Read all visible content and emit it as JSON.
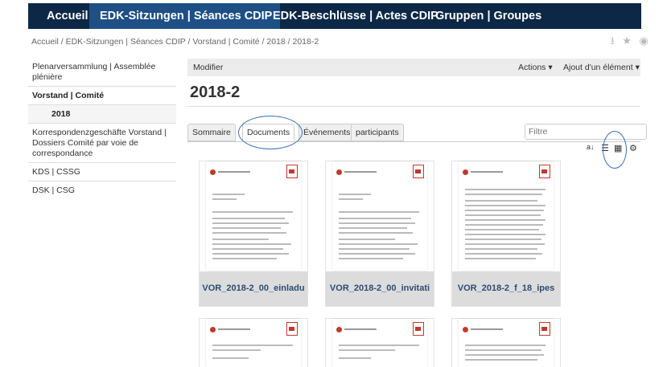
{
  "topnav": {
    "items": [
      "Accueil",
      "EDK-Sitzungen | Séances CDIP",
      "EDK-Beschlüsse | Actes CDIP",
      "Gruppen | Groupes"
    ]
  },
  "breadcrumb": "Accueil / EDK-Sitzungen | Séances CDIP / Vorstand | Comité / 2018 / 2018-2",
  "leftnav": {
    "items": [
      "Plenarversammlung | Assemblée plénière",
      "Vorstand | Comité",
      "2018",
      "Korrespondenzgeschäfte Vorstand | Dossiers Comité par voie de correspondance",
      "KDS | CSSG",
      "DSK | CSG"
    ]
  },
  "toolbar": {
    "modify": "Modifier",
    "actions": "Actions ▾",
    "add": "Ajout d'un élément ▾"
  },
  "page_title": "2018-2",
  "tabs": [
    "Sommaire",
    "Documents",
    "Événements",
    "participants"
  ],
  "active_tab": "Documents",
  "filter": {
    "placeholder": "Filtre"
  },
  "cards": [
    {
      "label": "VOR_2018-2_00_einladu"
    },
    {
      "label": "VOR_2018-2_00_invitati"
    },
    {
      "label": "VOR_2018-2_f_18_ipes"
    },
    {
      "label": ""
    },
    {
      "label": ""
    },
    {
      "label": ""
    }
  ],
  "colors": {
    "nav_bg": "#0d2847",
    "nav_active": "#1e4f85",
    "highlight_circle": "#3a6fb5",
    "pdf": "#c0392b"
  },
  "icons": {
    "download": "download-icon",
    "star": "star-icon",
    "watch": "eye-icon"
  }
}
